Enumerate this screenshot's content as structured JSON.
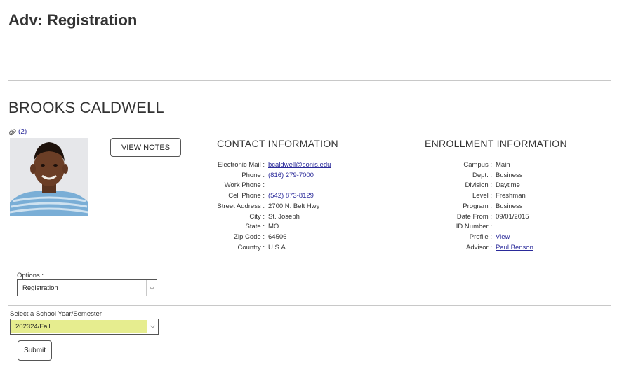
{
  "page": {
    "title": "Adv: Registration"
  },
  "student": {
    "name": "BROOKS CALDWELL",
    "attachments_count": "(2)"
  },
  "buttons": {
    "view_notes": "VIEW NOTES",
    "submit": "Submit"
  },
  "contact": {
    "heading": "CONTACT INFORMATION",
    "rows": [
      {
        "label": "Electronic Mail :",
        "value": "bcaldwell@sonis.edu",
        "link": true
      },
      {
        "label": "Phone :",
        "value": "(816) 279-7000",
        "link": true
      },
      {
        "label": "Work Phone :",
        "value": ""
      },
      {
        "label": "Cell Phone :",
        "value": "(542) 873-8129",
        "link": true
      },
      {
        "label": "Street Address :",
        "value": "2700 N. Belt Hwy"
      },
      {
        "label": "City :",
        "value": "St. Joseph"
      },
      {
        "label": "State :",
        "value": "MO"
      },
      {
        "label": "Zip Code :",
        "value": "64506"
      },
      {
        "label": "Country :",
        "value": "U.S.A."
      }
    ]
  },
  "enrollment": {
    "heading": "ENROLLMENT INFORMATION",
    "rows": [
      {
        "label": "Campus :",
        "value": "Main"
      },
      {
        "label": "Dept. :",
        "value": "Business"
      },
      {
        "label": "Division :",
        "value": "Daytime"
      },
      {
        "label": "Level :",
        "value": "Freshman"
      },
      {
        "label": "Program :",
        "value": "Business"
      },
      {
        "label": "Date From :",
        "value": "09/01/2015"
      },
      {
        "label": "ID Number :",
        "value": ""
      },
      {
        "label": "Profile :",
        "value": "View",
        "link": true
      },
      {
        "label": "Advisor :",
        "value": "Paul Benson",
        "link": true
      }
    ]
  },
  "options": {
    "label": "Options :",
    "selected": "Registration"
  },
  "semester": {
    "label": "Select a School Year/Semester",
    "selected": "202324/Fall",
    "highlight": "#e6ed8f"
  },
  "colors": {
    "link": "#2a2a9a",
    "text": "#333333",
    "divider": "#c8c8c8"
  }
}
